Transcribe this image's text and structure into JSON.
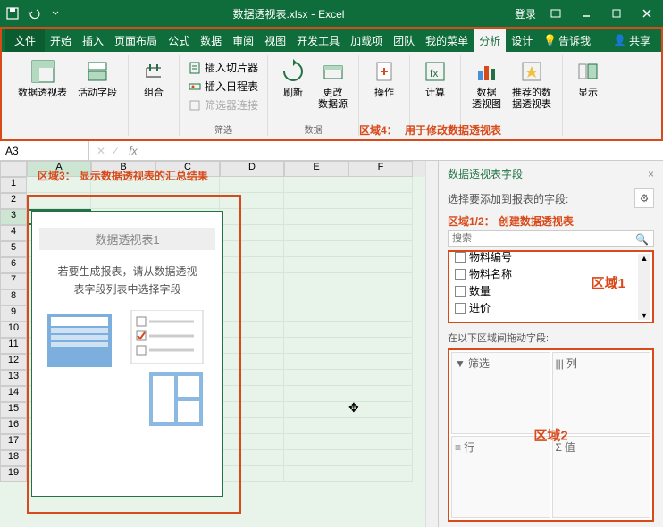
{
  "title": {
    "filename": "数据透视表.xlsx",
    "app": "Excel",
    "login": "登录"
  },
  "qat": {
    "save": "save",
    "undo": "undo",
    "redo": "redo"
  },
  "tabs": {
    "file": "文件",
    "home": "开始",
    "insert": "插入",
    "layout": "页面布局",
    "formula": "公式",
    "data": "数据",
    "review": "审阅",
    "view": "视图",
    "dev": "开发工具",
    "addins": "加载项",
    "team": "团队",
    "mymenu": "我的菜单",
    "analyze": "分析",
    "design": "设计",
    "tellme": "告诉我",
    "share": "共享"
  },
  "ribbon": {
    "g1": {
      "pivot": "数据透视表",
      "activefield": "活动字段"
    },
    "g2": {
      "group": "组合"
    },
    "g3": {
      "slicer": "插入切片器",
      "timeline": "插入日程表",
      "filterconn": "筛选器连接",
      "label": "筛选"
    },
    "g4": {
      "refresh": "刷新",
      "changesrc": "更改\n数据源",
      "label": "数据"
    },
    "g5": {
      "actions": "操作"
    },
    "g6": {
      "calc": "计算"
    },
    "g7": {
      "pivotchart": "数据\n透视图",
      "recommend": "推荐的数\n据透视表"
    },
    "g8": {
      "show": "显示"
    }
  },
  "annotations": {
    "a4_label": "区域4：",
    "a4_text": "用于修改数据透视表",
    "a3_label": "区域3：",
    "a3_text": "显示数据透视表的汇总结果",
    "a12_label": "区域1/2：",
    "a12_text": "创建数据透视表",
    "a1": "区域1",
    "a2": "区域2"
  },
  "namebox": "A3",
  "cols": [
    "A",
    "B",
    "C",
    "D",
    "E",
    "F"
  ],
  "pivotbox": {
    "title": "数据透视表1",
    "text1": "若要生成报表，请从数据透视",
    "text2": "表字段列表中选择字段"
  },
  "pane": {
    "title": "数据透视表字段",
    "close": "×",
    "sub": "选择要添加到报表的字段:",
    "search": "搜索",
    "fields": [
      "物料编号",
      "物料名称",
      "数量",
      "进价"
    ],
    "areas_label": "在以下区域间拖动字段:",
    "filter": "筛选",
    "columns": "列",
    "rows": "行",
    "values": "值"
  }
}
